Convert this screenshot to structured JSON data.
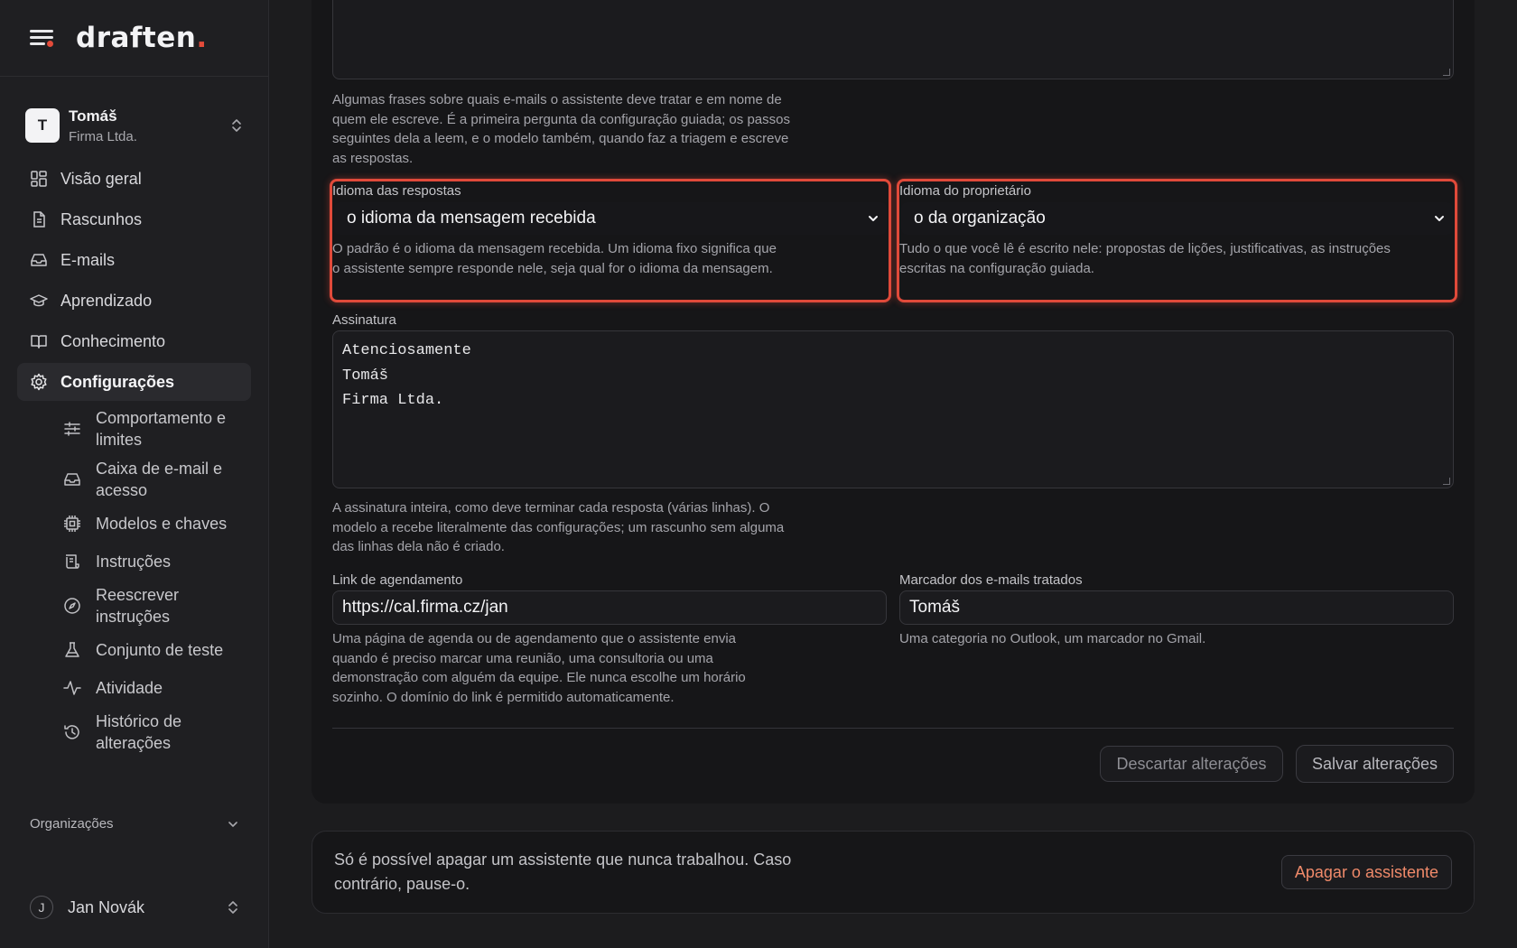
{
  "brand": {
    "name": "draften",
    "dot": "."
  },
  "account": {
    "initial": "T",
    "name": "Tomáš",
    "org": "Firma Ltda."
  },
  "nav": {
    "items": [
      {
        "label": "Visão geral"
      },
      {
        "label": "Rascunhos"
      },
      {
        "label": "E-mails"
      },
      {
        "label": "Aprendizado"
      },
      {
        "label": "Conhecimento"
      },
      {
        "label": "Configurações"
      }
    ],
    "sub_items": [
      {
        "label": "Comportamento e limites"
      },
      {
        "label": "Caixa de e-mail e acesso"
      },
      {
        "label": "Modelos e chaves"
      },
      {
        "label": "Instruções"
      },
      {
        "label": "Reescrever instruções"
      },
      {
        "label": "Conjunto de teste"
      },
      {
        "label": "Atividade"
      },
      {
        "label": "Histórico de alterações"
      }
    ],
    "organizations_label": "Organizações"
  },
  "user": {
    "initial": "J",
    "name": "Jan Novák"
  },
  "form": {
    "scope_help": "Algumas frases sobre quais e-mails o assistente deve tratar e em nome de quem ele escreve. É a primeira pergunta da configuração guiada; os passos seguintes dela a leem, e o modelo também, quando faz a triagem e escreve as respostas.",
    "reply_language": {
      "label": "Idioma das respostas",
      "value": "o idioma da mensagem recebida",
      "help": "O padrão é o idioma da mensagem recebida. Um idioma fixo significa que o assistente sempre responde nele, seja qual for o idioma da mensagem."
    },
    "owner_language": {
      "label": "Idioma do proprietário",
      "value": "o da organização",
      "help": "Tudo o que você lê é escrito nele: propostas de lições, justificativas, as instruções escritas na configuração guiada."
    },
    "signature": {
      "label": "Assinatura",
      "lines": [
        "Atenciosamente",
        "Tomáš",
        "Firma Ltda."
      ],
      "help": "A assinatura inteira, como deve terminar cada resposta (várias linhas). O modelo a recebe literalmente das configurações; um rascunho sem alguma das linhas dela não é criado."
    },
    "scheduling_link": {
      "label": "Link de agendamento",
      "value": "https://cal.firma.cz/jan",
      "help": "Uma página de agenda ou de agendamento que o assistente envia quando é preciso marcar uma reunião, uma consultoria ou uma demonstração com alguém da equipe. Ele nunca escolhe um horário sozinho. O domínio do link é permitido automaticamente."
    },
    "handled_marker": {
      "label": "Marcador dos e-mails tratados",
      "value": "Tomáš",
      "help": "Uma categoria no Outlook, um marcador no Gmail."
    },
    "discard_label": "Descartar alterações",
    "save_label": "Salvar alterações"
  },
  "danger": {
    "text": "Só é possível apagar um assistente que nunca trabalhou. Caso contrário, pause-o.",
    "button_label": "Apagar o assistente"
  },
  "colors": {
    "accent": "#e34b3a",
    "highlight": "#e04a3a",
    "danger_text": "#f08a6a"
  }
}
